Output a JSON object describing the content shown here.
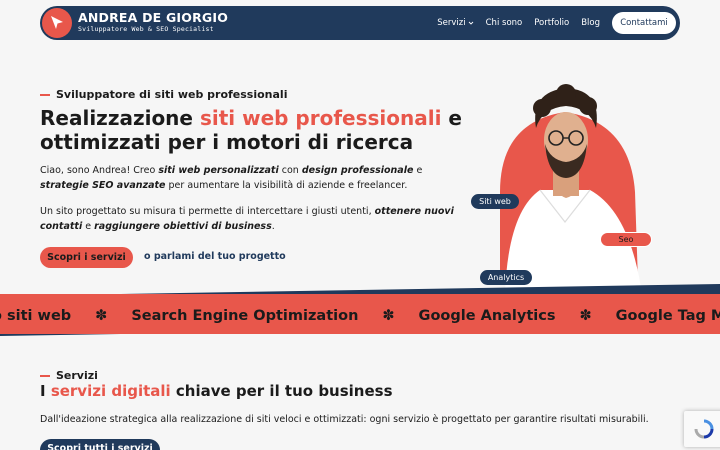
{
  "nav": {
    "logo_title": "ANDREA DE GIORGIO",
    "logo_subtitle": "Sviluppatore Web & SEO Specialist",
    "links": [
      {
        "label": "Servizi",
        "has_dropdown": true
      },
      {
        "label": "Chi sono"
      },
      {
        "label": "Portfolio"
      },
      {
        "label": "Blog"
      }
    ],
    "cta": "Contattami"
  },
  "hero": {
    "eyebrow": "Sviluppatore di siti web professionali",
    "title_before": "Realizzazione ",
    "title_accent": "siti web professionali",
    "title_after": " e ottimizzati per i motori di ricerca",
    "intro": {
      "t1": "Ciao, sono Andrea! Creo ",
      "b1": "siti web personalizzati",
      "t2": " con ",
      "b2": "design professionale",
      "t3": " e ",
      "b3": "strategie SEO avanzate",
      "t4": " per aumentare la visibilità di aziende e freelancer."
    },
    "body": {
      "t1": "Un sito progettato su misura ti permette di intercettare i giusti utenti, ",
      "b1": "ottenere nuovi contatti",
      "t2": " e ",
      "b2": "raggiungere obiettivi di business",
      "t3": "."
    },
    "primary_button": "Scopri i servizi",
    "secondary_link": "o parlami del tuo progetto",
    "tags": [
      "Siti web",
      "Seo",
      "Analytics"
    ]
  },
  "marquee": {
    "items": [
      "o siti web",
      "Search Engine Optimization",
      "Google Analytics",
      "Google Tag Ma"
    ],
    "separator": "✽"
  },
  "services": {
    "eyebrow": "Servizi",
    "title_before": "I ",
    "title_accent": "servizi digitali",
    "title_after": " chiave per il tuo business",
    "description": "Dall'ideazione strategica alla realizzazione di siti veloci e ottimizzati: ogni servizio è progettato per garantire risultati misurabili.",
    "button": "Scopri tutti i servizi"
  },
  "colors": {
    "navy": "#203a5c",
    "accent": "#e8574b",
    "background": "#f6f6f6"
  },
  "icons": [
    "logo-cursor-icon",
    "chevron-down-icon",
    "recaptcha-icon"
  ]
}
